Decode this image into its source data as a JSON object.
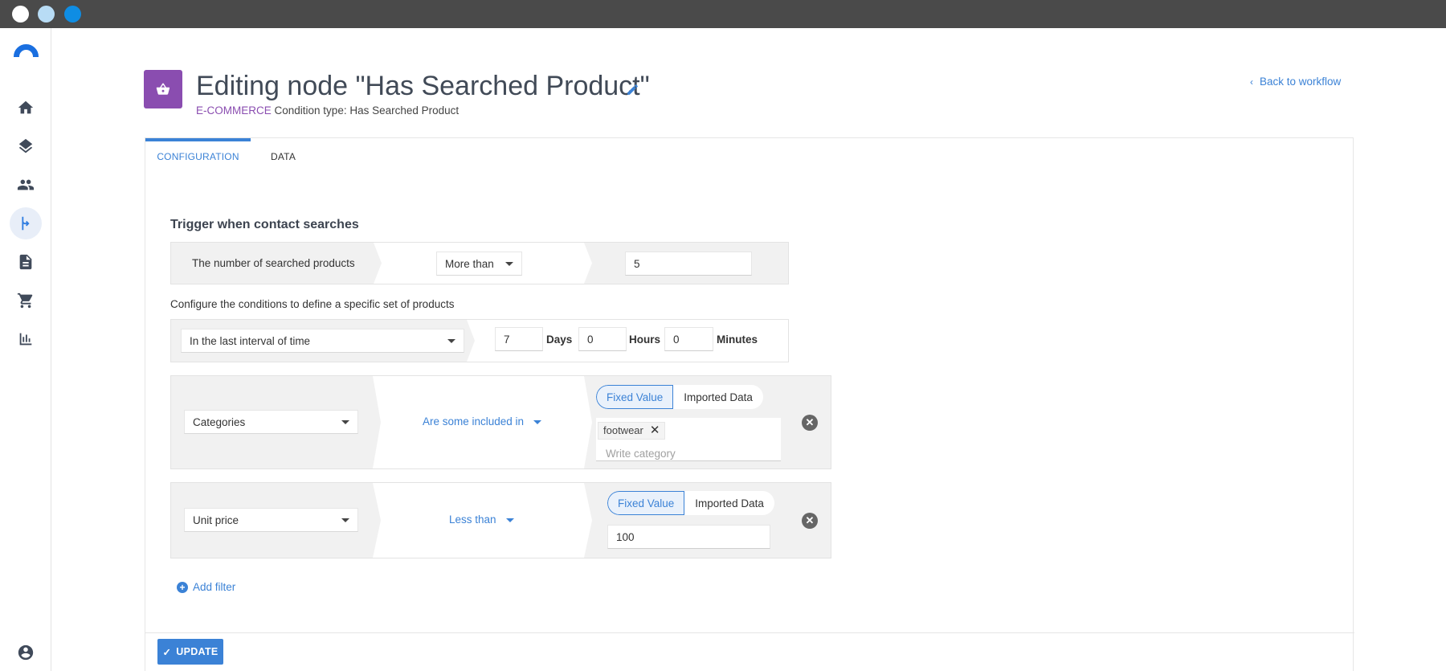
{
  "window": {
    "controls": [
      "close",
      "minimize",
      "maximize"
    ]
  },
  "sidebar": {
    "icons": [
      "logo-icon",
      "home-icon",
      "layers-icon",
      "contacts-icon",
      "workflow-icon",
      "document-icon",
      "cart-icon",
      "chart-icon",
      "user-icon"
    ],
    "active": "workflow-icon"
  },
  "header": {
    "title": "Editing node \"Has Searched Product\"",
    "category": "E-COMMERCE",
    "condition_type": "Condition type: Has Searched Product",
    "back_link": "Back to workflow"
  },
  "tabs": {
    "configuration": "CONFIGURATION",
    "data": "DATA"
  },
  "trigger": {
    "title": "Trigger when contact searches",
    "count_label": "The number of searched products",
    "operator": "More than",
    "value": "5"
  },
  "conditions": {
    "description": "Configure the conditions to define a specific set of products",
    "interval_select": "In the last interval of time",
    "days_value": "7",
    "days_label": "Days",
    "hours_value": "0",
    "hours_label": "Hours",
    "minutes_value": "0",
    "minutes_label": "Minutes"
  },
  "filters": [
    {
      "field": "Categories",
      "operator": "Are some included in",
      "fixed_label": "Fixed Value",
      "imported_label": "Imported Data",
      "tag": "footwear",
      "placeholder": "Write category"
    },
    {
      "field": "Unit price",
      "operator": "Less than",
      "fixed_label": "Fixed Value",
      "imported_label": "Imported Data",
      "value": "100"
    }
  ],
  "actions": {
    "add_filter": "Add filter",
    "update": "UPDATE"
  },
  "colors": {
    "accent": "#3b82d6",
    "category": "#8a4db0",
    "titlebar": "#4a4a4a"
  }
}
